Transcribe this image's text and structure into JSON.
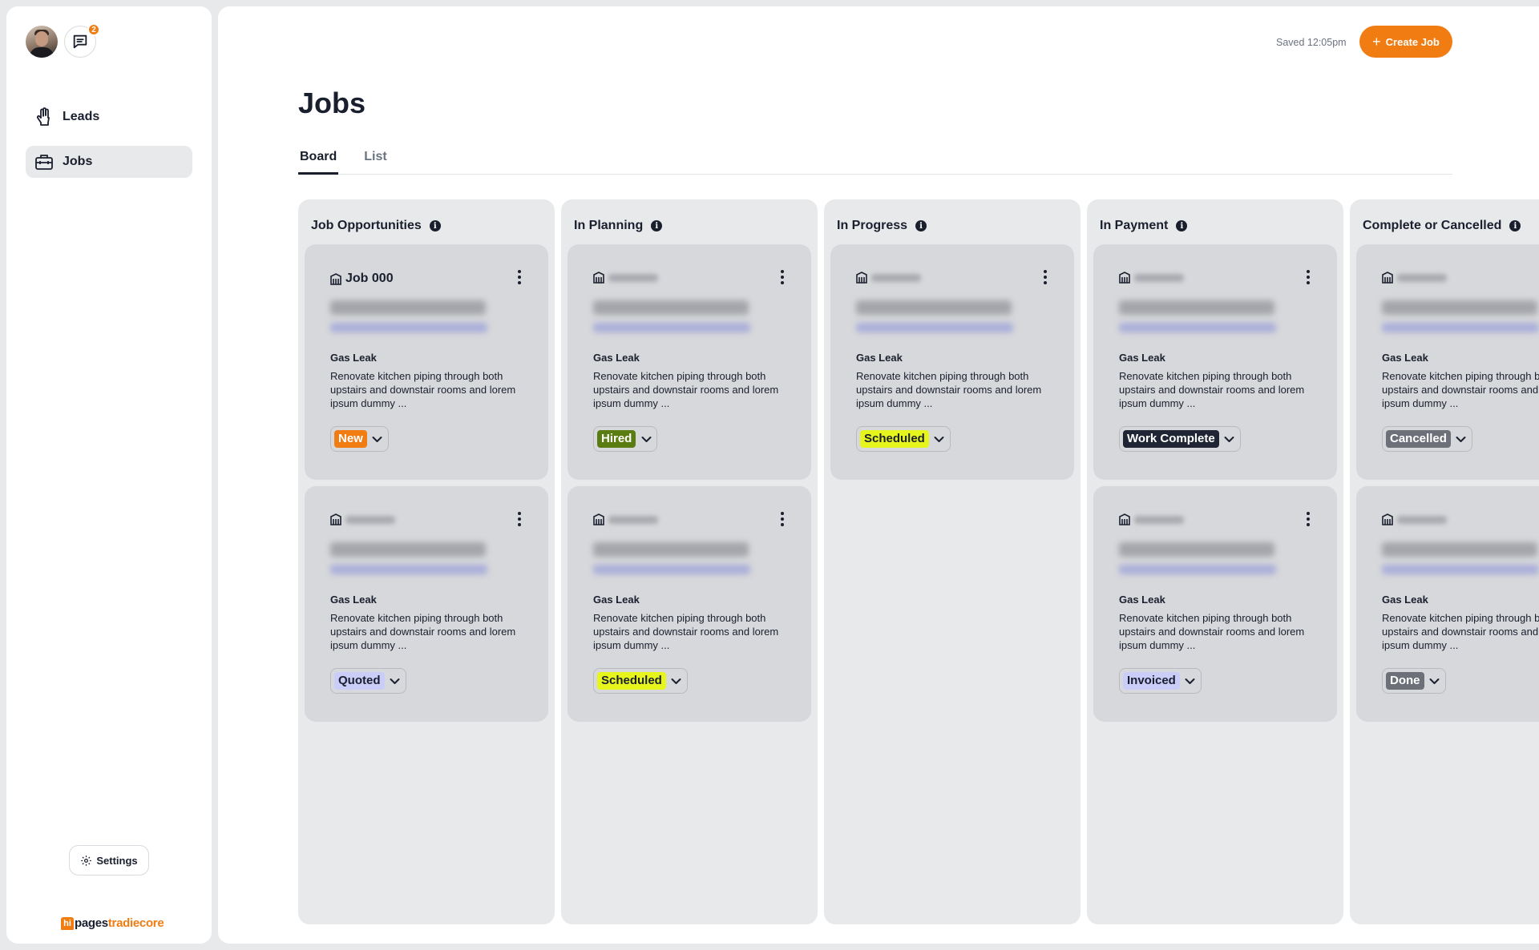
{
  "sidebar": {
    "message_badge_count": "2",
    "nav": [
      {
        "label": "Leads",
        "icon": "hand-icon"
      },
      {
        "label": "Jobs",
        "icon": "briefcase-icon"
      }
    ],
    "settings_label": "Settings",
    "brand": {
      "hi": "hi",
      "pages": "pages",
      "tradiecore": "tradiecore"
    }
  },
  "header": {
    "saved_text": "Saved 12:05pm",
    "create_button_label": "Create Job",
    "page_title": "Jobs"
  },
  "tabs": [
    {
      "label": "Board",
      "active": true
    },
    {
      "label": "List",
      "active": false
    }
  ],
  "columns": [
    {
      "title": "Job Opportunities",
      "cards": [
        {
          "job": "Job 000",
          "type": "Gas Leak",
          "description": "Renovate kitchen piping through both upstairs and downstair rooms and lorem ipsum dummy ...",
          "status": "New"
        },
        {
          "job": "",
          "type": "Gas Leak",
          "description": "Renovate kitchen piping through both upstairs and downstair rooms and lorem ipsum dummy ...",
          "status": "Quoted"
        }
      ]
    },
    {
      "title": "In Planning",
      "cards": [
        {
          "job": "",
          "type": "Gas Leak",
          "description": "Renovate kitchen piping through both upstairs and downstair rooms and lorem ipsum dummy ...",
          "status": "Hired"
        },
        {
          "job": "",
          "type": "Gas Leak",
          "description": "Renovate kitchen piping through both upstairs and downstair rooms and lorem ipsum dummy ...",
          "status": "Scheduled"
        }
      ]
    },
    {
      "title": "In Progress",
      "cards": [
        {
          "job": "",
          "type": "Gas Leak",
          "description": "Renovate kitchen piping through both upstairs and downstair rooms and lorem ipsum dummy ...",
          "status": "Scheduled"
        }
      ]
    },
    {
      "title": "In Payment",
      "cards": [
        {
          "job": "",
          "type": "Gas Leak",
          "description": "Renovate kitchen piping through both upstairs and downstair rooms and lorem ipsum dummy ...",
          "status": "Work Complete"
        },
        {
          "job": "",
          "type": "Gas Leak",
          "description": "Renovate kitchen piping through both upstairs and downstair rooms and lorem ipsum dummy ...",
          "status": "Invoiced"
        }
      ]
    },
    {
      "title": "Complete or Cancelled",
      "cards": [
        {
          "job": "",
          "type": "Gas Leak",
          "description": "Renovate kitchen piping through both upstairs and downstair rooms and lorem ipsum dummy ...",
          "status": "Cancelled"
        },
        {
          "job": "",
          "type": "Gas Leak",
          "description": "Renovate kitchen piping through both upstairs and downstair rooms and lorem ipsum dummy ...",
          "status": "Done"
        }
      ]
    }
  ],
  "status_colors": {
    "New": {
      "bg": "#f07c12",
      "fg": "#ffffff"
    },
    "Quoted": {
      "bg": "#c9cdf7",
      "fg": "#1a1f2e"
    },
    "Hired": {
      "bg": "#5a7d12",
      "fg": "#ffffff"
    },
    "Scheduled": {
      "bg": "#e6f51c",
      "fg": "#1a1f2e"
    },
    "Work Complete": {
      "bg": "#1f2535",
      "fg": "#ffffff"
    },
    "Invoiced": {
      "bg": "#c9cdf7",
      "fg": "#1a1f2e"
    },
    "Cancelled": {
      "bg": "#6d7078",
      "fg": "#ffffff"
    },
    "Done": {
      "bg": "#6d7078",
      "fg": "#ffffff"
    }
  },
  "accent_color": "#f07c12"
}
